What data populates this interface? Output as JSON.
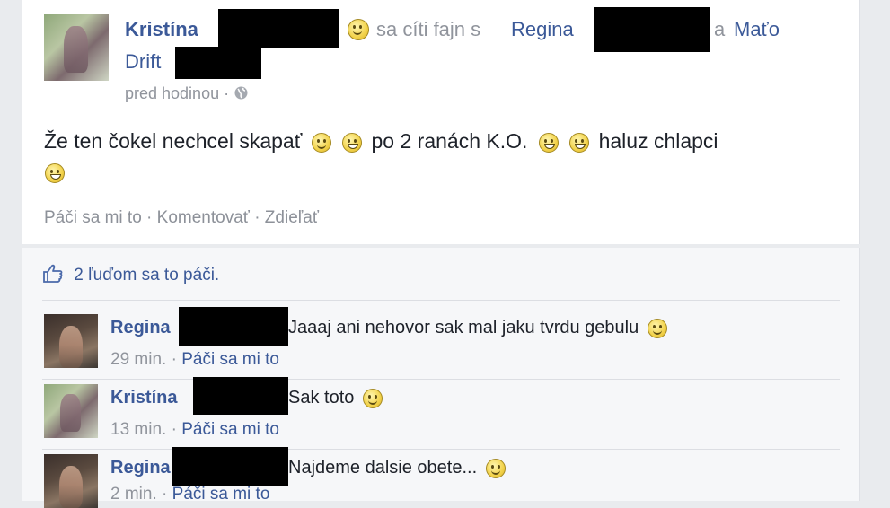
{
  "post": {
    "author": "Kristína",
    "feeling_text": "sa cíti fajn s",
    "tagged_1": "Regina",
    "conjunction": "a",
    "tagged_2_line1": "Maťo",
    "tagged_2_line2": "Drift",
    "time": "pred hodinou",
    "separator": "·",
    "text_part1": "Že ten čokel nechcel skapať",
    "text_part2": "po 2 ranách K.O.",
    "text_part3": "haluz chlapci",
    "actions": {
      "like": "Páči sa mi to",
      "comment": "Komentovať",
      "share": "Zdieľať",
      "sep": "·"
    }
  },
  "likes_summary": "2 ľuďom sa to páči.",
  "comments": [
    {
      "author": "Regina",
      "text": "Jaaaj ani nehovor sak mal jaku tvrdu gebulu",
      "time": "29 min.",
      "like": "Páči sa mi to"
    },
    {
      "author": "Kristína",
      "text": "Sak toto",
      "time": "13 min.",
      "like": "Páči sa mi to"
    },
    {
      "author": "Regina",
      "text": "Najdeme dalsie obete...",
      "time": "2 min.",
      "like": "Páči sa mi to"
    }
  ],
  "colors": {
    "name": "#3b5998",
    "meta": "#90949c",
    "background": "#e9ebee"
  },
  "icons": [
    "globe-icon",
    "smiley-icon",
    "grin-icon",
    "thumbs-up-icon"
  ]
}
